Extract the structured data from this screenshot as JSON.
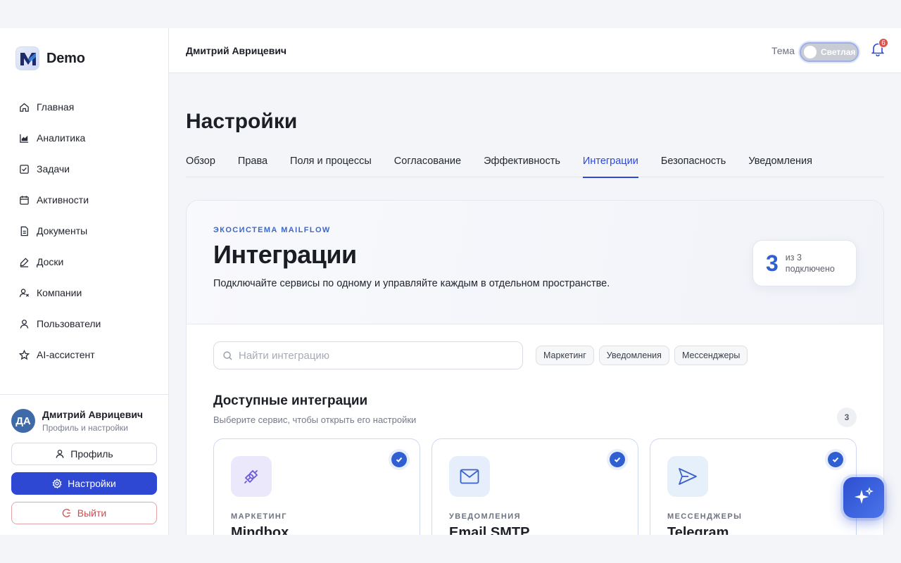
{
  "brand": {
    "name": "Demo"
  },
  "sidebar": {
    "items": [
      {
        "label": "Главная",
        "icon": "home-icon"
      },
      {
        "label": "Аналитика",
        "icon": "chart-icon"
      },
      {
        "label": "Задачи",
        "icon": "checkbox-icon"
      },
      {
        "label": "Активности",
        "icon": "calendar-icon"
      },
      {
        "label": "Документы",
        "icon": "document-icon"
      },
      {
        "label": "Доски",
        "icon": "pen-icon"
      },
      {
        "label": "Компании",
        "icon": "companies-icon"
      },
      {
        "label": "Пользователи",
        "icon": "user-icon"
      },
      {
        "label": "AI-ассистент",
        "icon": "star-icon"
      }
    ],
    "user": {
      "initials": "ДА",
      "name": "Дмитрий Аврицевич",
      "subtitle": "Профиль и настройки"
    },
    "profile_label": "Профиль",
    "settings_label": "Настройки",
    "logout_label": "Выйти"
  },
  "topbar": {
    "user_name": "Дмитрий Аврицевич",
    "theme_label": "Тема",
    "theme_value": "Светлая",
    "notifications_count": "6"
  },
  "page": {
    "title": "Настройки",
    "tabs": [
      {
        "label": "Обзор"
      },
      {
        "label": "Права"
      },
      {
        "label": "Поля и процессы"
      },
      {
        "label": "Согласование"
      },
      {
        "label": "Эффективность"
      },
      {
        "label": "Интеграции",
        "active": true
      },
      {
        "label": "Безопасность"
      },
      {
        "label": "Уведомления"
      }
    ]
  },
  "integrations": {
    "eyebrow": "ЭКОСИСТЕМА MAILFLOW",
    "title": "Интеграции",
    "description": "Подключайте сервисы по одному и управляйте каждым в отдельном пространстве.",
    "stat": {
      "value": "3",
      "line1": "из 3",
      "line2": "подключено"
    },
    "search": {
      "placeholder": "Найти интеграцию",
      "value": ""
    },
    "filters": [
      "Маркетинг",
      "Уведомления",
      "Мессенджеры"
    ],
    "section_title": "Доступные интеграции",
    "section_subtitle": "Выберите сервис, чтобы открыть его настройки",
    "count": "3",
    "cards": [
      {
        "category": "МАРКЕТИНГ",
        "name": "Mindbox",
        "icon": "plug-icon",
        "icon_bg": "#ece8fb",
        "connected": true
      },
      {
        "category": "УВЕДОМЛЕНИЯ",
        "name": "Email SMTP",
        "icon": "mail-icon",
        "icon_bg": "#e6eefb",
        "connected": true
      },
      {
        "category": "МЕССЕНДЖЕРЫ",
        "name": "Telegram",
        "icon": "send-icon",
        "icon_bg": "#e6f0fb",
        "connected": true
      }
    ]
  },
  "colors": {
    "accent": "#2f48d4",
    "link": "#2f5fd0",
    "danger": "#cf4a4e"
  }
}
